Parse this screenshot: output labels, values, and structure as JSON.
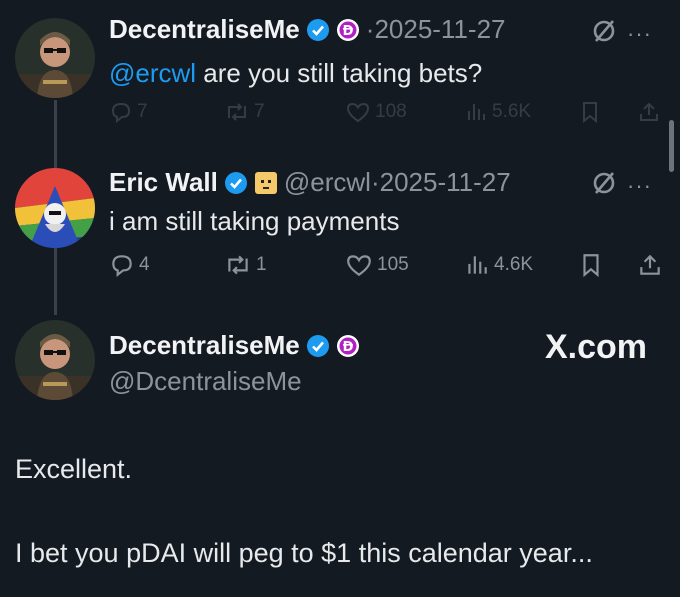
{
  "colors": {
    "background": "#141a22",
    "accent": "#1d9bf0",
    "muted": "#8b949c",
    "text": "#e7e9ea"
  },
  "tweets": [
    {
      "author": "DecentraliseMe",
      "separator": "·",
      "date": "2025-11-27",
      "mention": "@ercwl",
      "text": " are you still taking bets?",
      "replies": "7",
      "reposts": "7",
      "likes": "108",
      "views": "5.6K",
      "icons": [
        "verified-badge-icon",
        "dai-token-icon",
        "grok-icon",
        "more-icon"
      ]
    },
    {
      "author": "Eric Wall",
      "handle": "@ercwl",
      "separator": "·",
      "date": "2025-11-27",
      "text": "i am still taking payments",
      "replies": "4",
      "reposts": "1",
      "likes": "105",
      "views": "4.6K",
      "icons": [
        "verified-badge-icon",
        "emoji-badge-icon",
        "grok-icon",
        "more-icon"
      ]
    }
  ],
  "main_tweet": {
    "author": "DecentraliseMe",
    "handle": "@DcentraliseMe",
    "brand": "X.com",
    "line1": "Excellent.",
    "line2": "I bet you pDAI will peg to $1 this calendar year..."
  }
}
